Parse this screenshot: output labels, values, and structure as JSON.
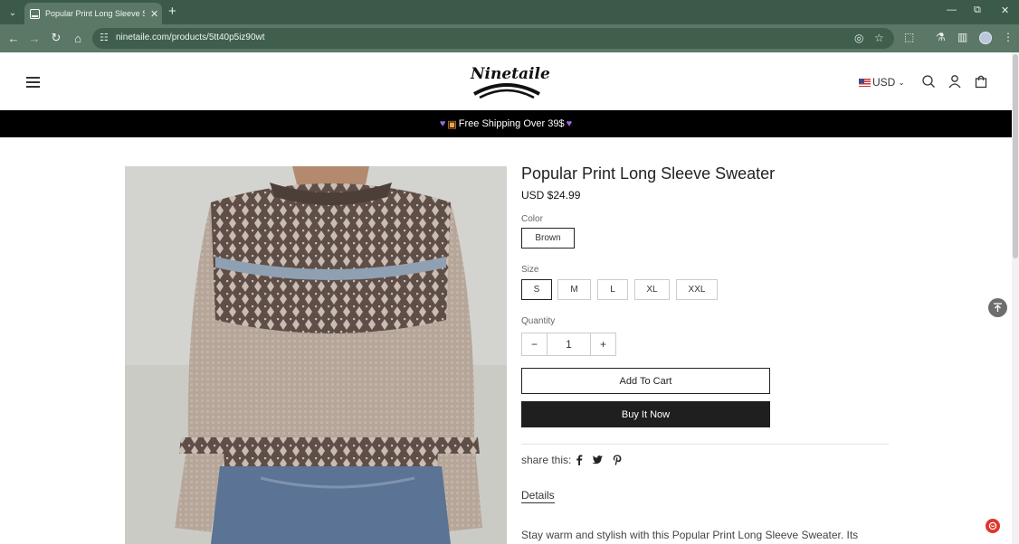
{
  "browser": {
    "tab_title": "Popular Print Long Sleeve Sweater",
    "url": "ninetaile.com/products/5tt40p5iz90wt"
  },
  "header": {
    "logo_text": "Ninetaile",
    "currency": "USD"
  },
  "promo": {
    "text": "Free Shipping Over 39$"
  },
  "product": {
    "title": "Popular Print Long Sleeve Sweater",
    "price": "USD $24.99",
    "color_label": "Color",
    "colors": [
      "Brown"
    ],
    "selected_color": "Brown",
    "size_label": "Size",
    "sizes": [
      "S",
      "M",
      "L",
      "XL",
      "XXL"
    ],
    "selected_size": "S",
    "quantity_label": "Quantity",
    "quantity": "1",
    "add_to_cart": "Add To Cart",
    "buy_now": "Buy It Now",
    "share_label": "share this:",
    "details_label": "Details",
    "description": "Stay warm and stylish with this Popular Print Long Sleeve Sweater. Its"
  },
  "icons": {
    "social": [
      "facebook-icon",
      "twitter-icon",
      "pinterest-icon"
    ]
  },
  "colors": {
    "promo_bg": "#000000",
    "buy_now_bg": "#1f1f1f",
    "browser_chrome": "#3c5a4a"
  }
}
